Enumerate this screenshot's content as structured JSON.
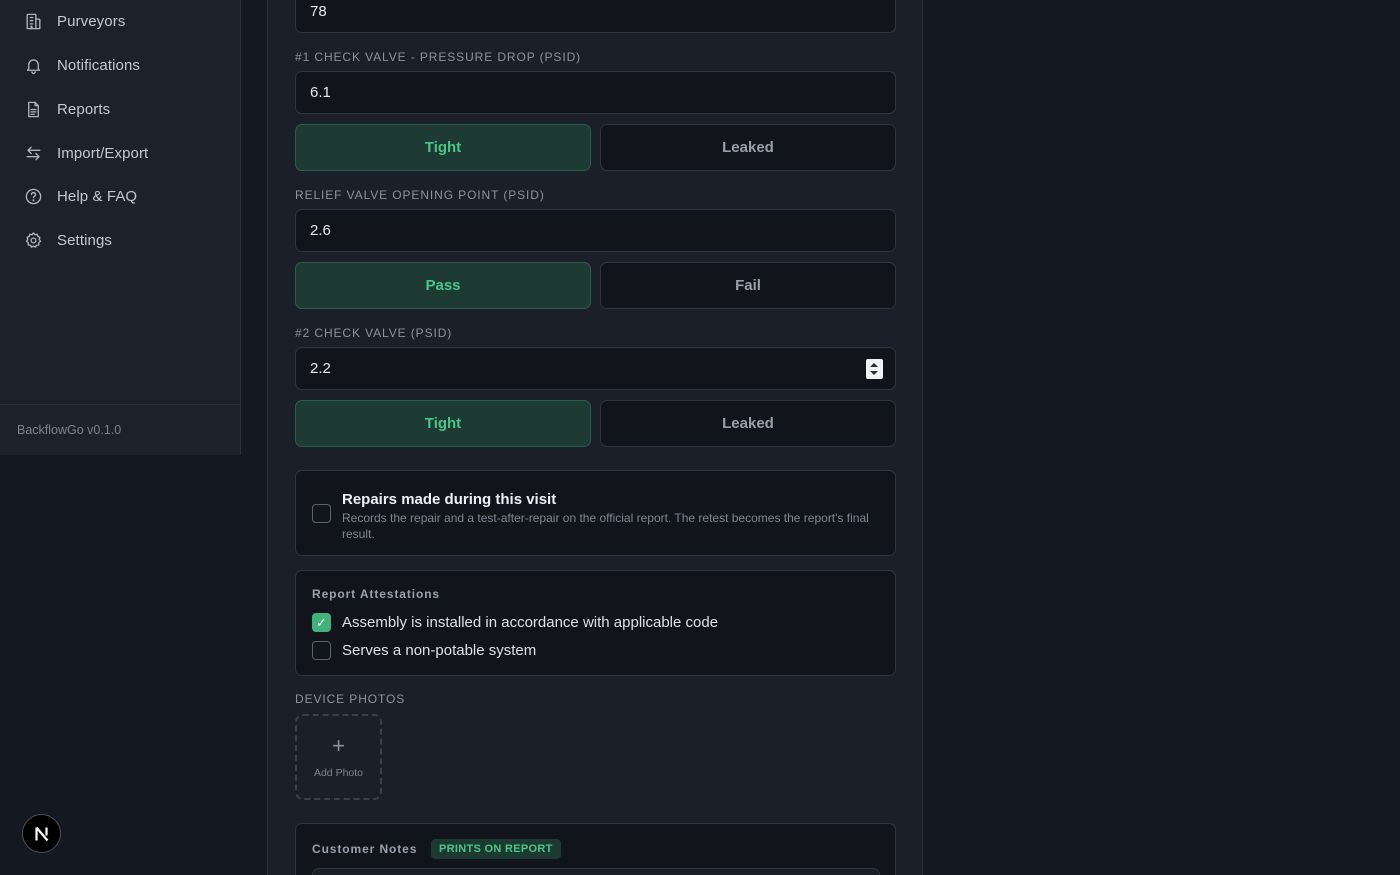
{
  "sidebar": {
    "items": [
      {
        "label": "Purveyors",
        "icon": "building-icon"
      },
      {
        "label": "Notifications",
        "icon": "bell-icon"
      },
      {
        "label": "Reports",
        "icon": "document-icon"
      },
      {
        "label": "Import/Export",
        "icon": "arrows-icon"
      },
      {
        "label": "Help & FAQ",
        "icon": "help-icon"
      },
      {
        "label": "Settings",
        "icon": "gear-icon"
      }
    ],
    "version": "BackflowGo v0.1.0"
  },
  "form": {
    "top_value": "78",
    "check1": {
      "label": "#1 Check Valve - Pressure Drop (PSID)",
      "value": "6.1",
      "option_a": "Tight",
      "option_b": "Leaked",
      "selected": "Tight"
    },
    "relief": {
      "label": "Relief Valve Opening Point (PSID)",
      "value": "2.6",
      "option_a": "Pass",
      "option_b": "Fail",
      "selected": "Pass"
    },
    "check2": {
      "label": "#2 Check Valve (PSID)",
      "value": "2.2",
      "option_a": "Tight",
      "option_b": "Leaked",
      "selected": "Tight"
    },
    "repairs": {
      "title": "Repairs made during this visit",
      "description": "Records the repair and a test-after-repair on the official report. The retest becomes the report's final result.",
      "checked": false
    },
    "attestations": {
      "title": "Report Attestations",
      "items": [
        {
          "label": "Assembly is installed in accordance with applicable code",
          "checked": true
        },
        {
          "label": "Serves a non-potable system",
          "checked": false
        }
      ]
    },
    "photos": {
      "label": "Device Photos",
      "plus": "+",
      "add_label": "Add Photo"
    },
    "notes": {
      "title": "Customer Notes",
      "badge": "Prints on Report"
    }
  },
  "fab": {
    "letter": "N"
  },
  "colors": {
    "accent_green": "#4cc58a",
    "checkbox_green": "#3fb37a",
    "background": "#141821",
    "panel": "#1b1f29"
  }
}
